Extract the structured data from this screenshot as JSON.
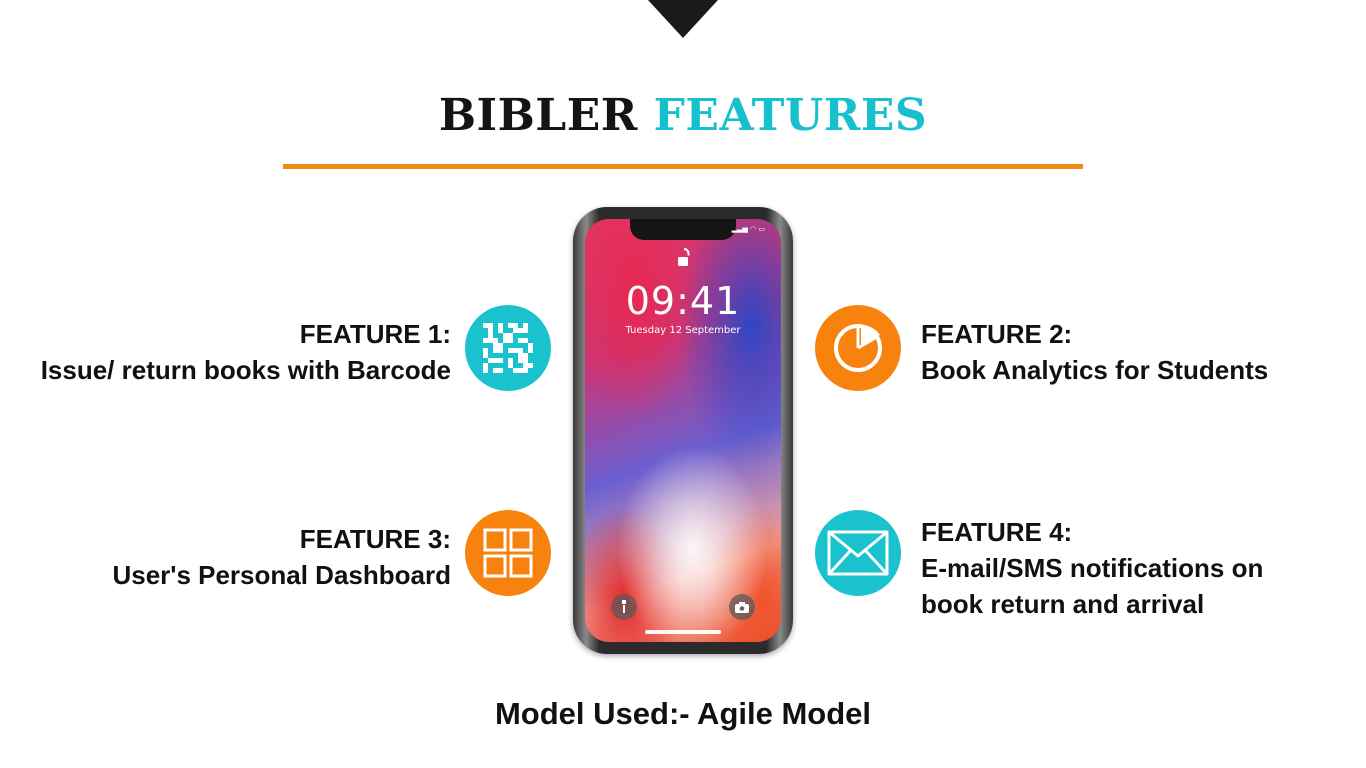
{
  "title": {
    "word1": "BIBLER",
    "word2": "FEATURES"
  },
  "phone": {
    "time": "09:41",
    "date": "Tuesday 12 September"
  },
  "features": [
    {
      "heading": "FEATURE 1:",
      "lines": [
        "Issue/ return books with Barcode"
      ],
      "icon": "barcode-icon",
      "color": "#19c2cd"
    },
    {
      "heading": "FEATURE 2:",
      "lines": [
        "Book Analytics for Students"
      ],
      "icon": "pie-chart-icon",
      "color": "#f7820d"
    },
    {
      "heading": "FEATURE 3:",
      "lines": [
        "User's Personal Dashboard"
      ],
      "icon": "dashboard-grid-icon",
      "color": "#f7820d"
    },
    {
      "heading": "FEATURE 4:",
      "lines": [
        "E-mail/SMS notifications on",
        "book return and arrival"
      ],
      "icon": "envelope-icon",
      "color": "#19c2cd"
    }
  ],
  "footer": "Model Used:- Agile Model",
  "colors": {
    "accent_teal": "#17c0cc",
    "accent_orange": "#f28a12",
    "text": "#111111"
  }
}
